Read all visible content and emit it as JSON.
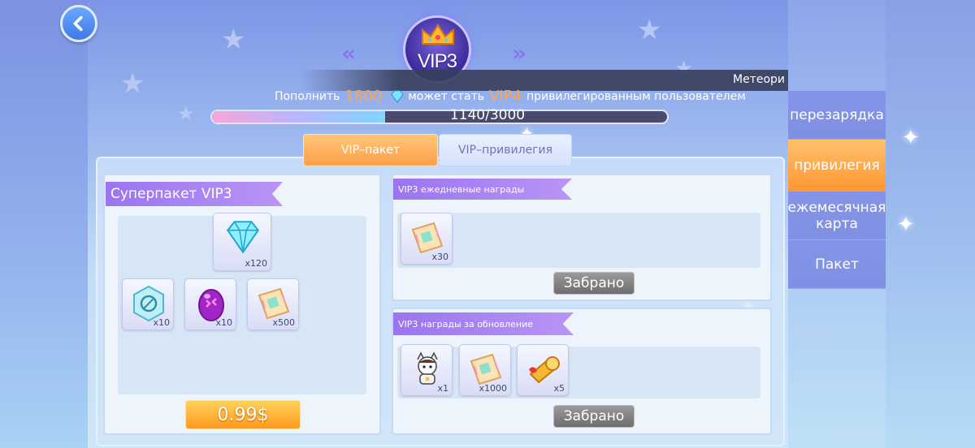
{
  "header": {
    "vip_level": "VIP3",
    "topup_prefix": "Пополнить",
    "topup_amount": "1800",
    "topup_middle": "может стать",
    "topup_next_vip": "VIP4",
    "topup_suffix": "привилегированным пользователем",
    "meteor_text": "Метеори",
    "progress_text": "1140/3000",
    "progress_fraction": 0.38
  },
  "tabs": [
    {
      "label": "VIP–пакет",
      "active": true
    },
    {
      "label": "VIP–привилегия",
      "active": false
    }
  ],
  "super_pack": {
    "title": "Суперпакет VIP3",
    "items": [
      {
        "icon": "diamond-icon",
        "qty": "x120"
      },
      {
        "icon": "crystal-badge-icon",
        "qty": "x10"
      },
      {
        "icon": "purple-egg-icon",
        "qty": "x10"
      },
      {
        "icon": "ticket-icon",
        "qty": "x500"
      }
    ],
    "price": "0.99$"
  },
  "daily_rewards": {
    "title": "VIP3 ежедневные награды",
    "items": [
      {
        "icon": "ticket-icon",
        "qty": "x30"
      }
    ],
    "button": "Забрано"
  },
  "update_rewards": {
    "title": "VIP3 награды за обновление",
    "items": [
      {
        "icon": "cat-costume-icon",
        "qty": "x1"
      },
      {
        "icon": "ticket-icon",
        "qty": "x1000"
      },
      {
        "icon": "horn-gadget-icon",
        "qty": "x5"
      }
    ],
    "button": "Забрано"
  },
  "sidebar": {
    "items": [
      {
        "label": "перезарядка",
        "active": false
      },
      {
        "label": "привилегия",
        "active": true
      },
      {
        "label": "ежемесячная карта",
        "active": false
      },
      {
        "label": "Пакет",
        "active": false
      }
    ]
  },
  "colors": {
    "accent_orange": "#ff9f4a",
    "ribbon_purple": "#9a75f0",
    "sidebar_blue": "#8495e8"
  }
}
